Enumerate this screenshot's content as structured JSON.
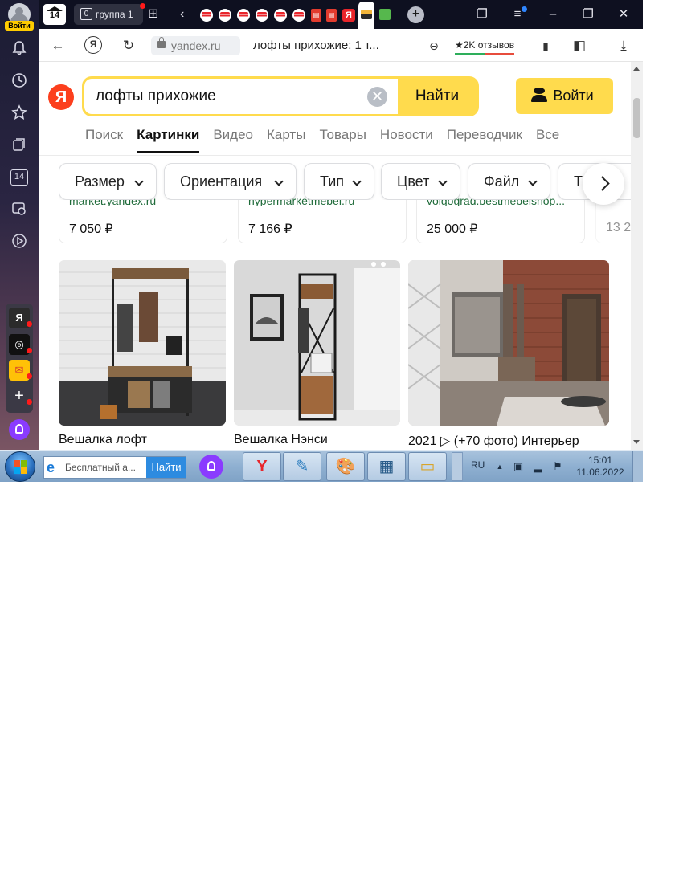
{
  "sidebar": {
    "login_label": "Войти",
    "app_badge": "14",
    "icons": [
      "bell-icon",
      "clock-icon",
      "star-icon",
      "collections-icon",
      "tabs-count-icon",
      "screenshot-icon",
      "play-icon"
    ],
    "apps": [
      {
        "name": "yandex-app",
        "glyph": "Я"
      },
      {
        "name": "alice-station-app",
        "glyph": "◎"
      },
      {
        "name": "mail-app",
        "glyph": "✉"
      },
      {
        "name": "add-app",
        "glyph": "+"
      }
    ]
  },
  "tabbar": {
    "home_count": "14",
    "group_count": "0",
    "group_label": "группа 1",
    "colors": {
      "background": "#0e1020",
      "notify_dot": "#ff1a1a"
    }
  },
  "addressbar": {
    "back_glyph": "←",
    "ya_glyph": "Я",
    "reload_glyph": "↻",
    "url": "yandex.ru",
    "title": "лофты прихожие: 1 т...",
    "reviews": "★2K отзывов"
  },
  "search": {
    "logo": "Я",
    "query": "лофты прихожие",
    "submit_label": "Найти",
    "login_label": "Войти",
    "colors": {
      "accent": "#ffdb4d",
      "logo": "#fc3f1d"
    }
  },
  "nav": {
    "items": [
      {
        "label": "Поиск",
        "active": false
      },
      {
        "label": "Картинки",
        "active": true
      },
      {
        "label": "Видео",
        "active": false
      },
      {
        "label": "Карты",
        "active": false
      },
      {
        "label": "Товары",
        "active": false
      },
      {
        "label": "Новости",
        "active": false
      },
      {
        "label": "Переводчик",
        "active": false
      },
      {
        "label": "Все",
        "active": false
      }
    ]
  },
  "filters": [
    "Размер",
    "Ориентация",
    "Тип",
    "Цвет",
    "Файл",
    "Т"
  ],
  "products": [
    {
      "source": "market.yandex.ru",
      "price": "7 050 ₽"
    },
    {
      "source": "hypermarketmebel.ru",
      "price": "7 166 ₽"
    },
    {
      "source": "volgograd.bestmebelshop...",
      "price": "25 000 ₽"
    },
    {
      "source": "",
      "price": "13 2"
    }
  ],
  "images": [
    {
      "caption": "Вешалка лофт"
    },
    {
      "caption": "Вешалка Нэнси"
    },
    {
      "caption": "2021 ▷  (+70 фото) Интерьер"
    }
  ],
  "taskbar": {
    "search_placeholder": "Бесплатный а...",
    "search_button": "Найти",
    "lang": "RU",
    "time": "15:01",
    "date": "11.06.2022"
  }
}
